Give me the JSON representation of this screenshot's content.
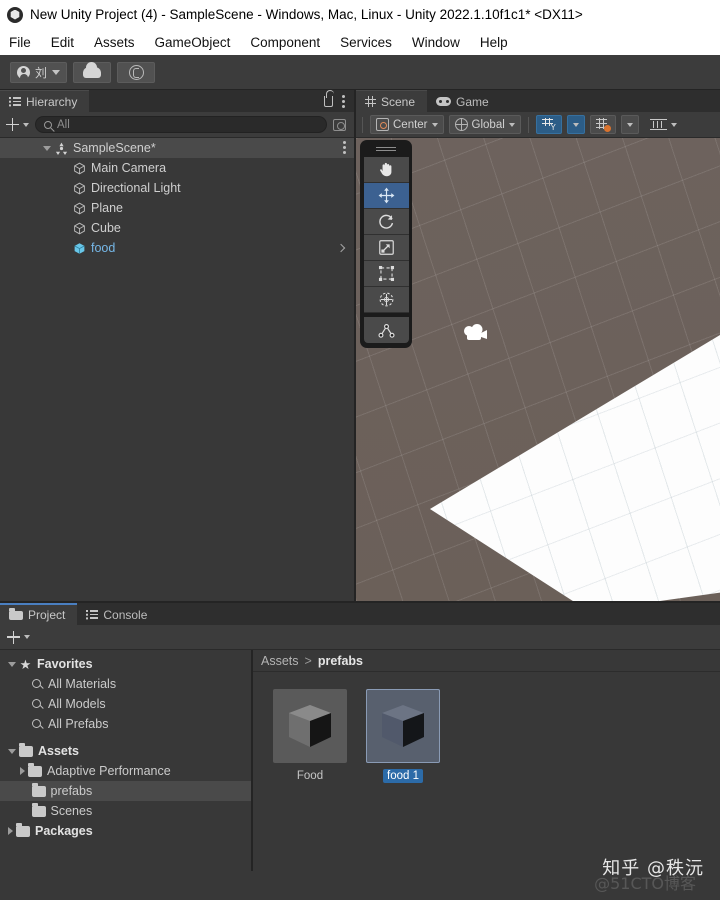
{
  "window": {
    "title": "New Unity Project (4) - SampleScene - Windows, Mac, Linux - Unity 2022.1.10f1c1* <DX11>",
    "logo_icon": "unity-logo"
  },
  "menubar": {
    "items": [
      {
        "label": "File"
      },
      {
        "label": "Edit"
      },
      {
        "label": "Assets"
      },
      {
        "label": "GameObject"
      },
      {
        "label": "Component"
      },
      {
        "label": "Services"
      },
      {
        "label": "Window"
      },
      {
        "label": "Help"
      }
    ]
  },
  "toolbar": {
    "account_label": "刘",
    "account_icon": "person-icon",
    "account_caret_icon": "chevron-down-icon",
    "cloud_icon": "cloud-icon",
    "services_icon": "unity-services-icon"
  },
  "hierarchy": {
    "tab_label": "Hierarchy",
    "tab_icon": "hierarchy-icon",
    "lock_icon": "lock-open-icon",
    "menu_icon": "kebab-menu-icon",
    "add_label": "+",
    "add_caret_icon": "chevron-down-icon",
    "search": {
      "placeholder": "All",
      "value": "",
      "icon": "search-icon",
      "right_icon": "search-options-icon"
    },
    "items": [
      {
        "label": "SampleScene*",
        "icon": "unity-scene-icon",
        "depth": 0,
        "selected": true,
        "expanded": true,
        "has_menu": true,
        "color": "default"
      },
      {
        "label": "Main Camera",
        "icon": "gameobject-cube-icon",
        "depth": 1,
        "selected": false,
        "color": "default"
      },
      {
        "label": "Directional Light",
        "icon": "gameobject-cube-icon",
        "depth": 1,
        "selected": false,
        "color": "default"
      },
      {
        "label": "Plane",
        "icon": "gameobject-cube-icon",
        "depth": 1,
        "selected": false,
        "color": "default"
      },
      {
        "label": "Cube",
        "icon": "gameobject-cube-icon",
        "depth": 1,
        "selected": false,
        "color": "default"
      },
      {
        "label": "food",
        "icon": "prefab-cube-icon",
        "depth": 1,
        "selected": false,
        "color": "#76b8e8",
        "has_chevron": true
      }
    ]
  },
  "scene": {
    "tabs": [
      {
        "label": "Scene",
        "icon": "grid-icon",
        "active": true
      },
      {
        "label": "Game",
        "icon": "gamepad-icon",
        "active": false
      }
    ],
    "toolbar": {
      "pivot_label": "Center",
      "pivot_icon": "pivot-icon",
      "pivot_caret_icon": "chevron-down-icon",
      "handle_label": "Global",
      "handle_icon": "globe-icon",
      "handle_caret_icon": "chevron-down-icon",
      "grid_axis_icon": "grid-axis-y-icon",
      "grid_axis_caret_icon": "chevron-down-icon",
      "grid_snap_icon": "grid-snap-icon",
      "grid_snap_caret_icon": "chevron-down-icon",
      "snap_increment_icon": "snap-ruler-icon"
    },
    "tools": [
      {
        "name": "hand-tool",
        "icon": "hand-icon",
        "selected": false
      },
      {
        "name": "move-tool",
        "icon": "move-icon",
        "selected": true
      },
      {
        "name": "rotate-tool",
        "icon": "rotate-icon",
        "selected": false
      },
      {
        "name": "scale-tool",
        "icon": "scale-icon",
        "selected": false
      },
      {
        "name": "rect-tool",
        "icon": "rect-transform-icon",
        "selected": false
      },
      {
        "name": "transform-tool",
        "icon": "transform-icon",
        "selected": false
      },
      {
        "name": "custom-editor-tool",
        "icon": "custom-tool-icon",
        "selected": false
      }
    ],
    "gizmos": [
      {
        "name": "camera-gizmo",
        "icon": "camera-icon"
      }
    ]
  },
  "project": {
    "tabs": [
      {
        "label": "Project",
        "icon": "folder-icon",
        "active": true
      },
      {
        "label": "Console",
        "icon": "console-icon",
        "active": false
      }
    ],
    "add_label": "+",
    "add_caret_icon": "chevron-down-icon",
    "tree": [
      {
        "label": "Favorites",
        "icon": "star-icon",
        "depth": 0,
        "arrow": "down",
        "bold": true,
        "selected": false
      },
      {
        "label": "All Materials",
        "icon": "search-icon",
        "depth": 1,
        "arrow": "none",
        "bold": false,
        "selected": false
      },
      {
        "label": "All Models",
        "icon": "search-icon",
        "depth": 1,
        "arrow": "none",
        "bold": false,
        "selected": false
      },
      {
        "label": "All Prefabs",
        "icon": "search-icon",
        "depth": 1,
        "arrow": "none",
        "bold": false,
        "selected": false
      },
      {
        "label": "Assets",
        "icon": "folder-open-icon",
        "depth": 0,
        "arrow": "down",
        "bold": true,
        "selected": false
      },
      {
        "label": "Adaptive Performance",
        "icon": "folder-icon",
        "depth": 1,
        "arrow": "right",
        "bold": false,
        "selected": false
      },
      {
        "label": "prefabs",
        "icon": "folder-icon",
        "depth": 1,
        "arrow": "none",
        "bold": false,
        "selected": true
      },
      {
        "label": "Scenes",
        "icon": "folder-icon",
        "depth": 1,
        "arrow": "none",
        "bold": false,
        "selected": false
      },
      {
        "label": "Packages",
        "icon": "folder-icon",
        "depth": 0,
        "arrow": "right",
        "bold": true,
        "selected": false
      }
    ],
    "breadcrumb": {
      "root": "Assets",
      "separator": ">",
      "current": "prefabs"
    },
    "assets": [
      {
        "name": "Food",
        "icon": "prefab-thumbnail",
        "selected": false
      },
      {
        "name": "food 1",
        "icon": "prefab-thumbnail",
        "selected": true
      }
    ]
  },
  "watermark": {
    "main": "知乎 @秩沅",
    "sub": "@51CTO博客"
  },
  "colors": {
    "accent_blue": "#2c6ba8",
    "tool_selected": "#3c6191",
    "prefab_blue": "#76b8e8",
    "panel_bg": "#383838",
    "toolbar_bg": "#3c3c3c",
    "snap_orange": "#d9732e"
  }
}
